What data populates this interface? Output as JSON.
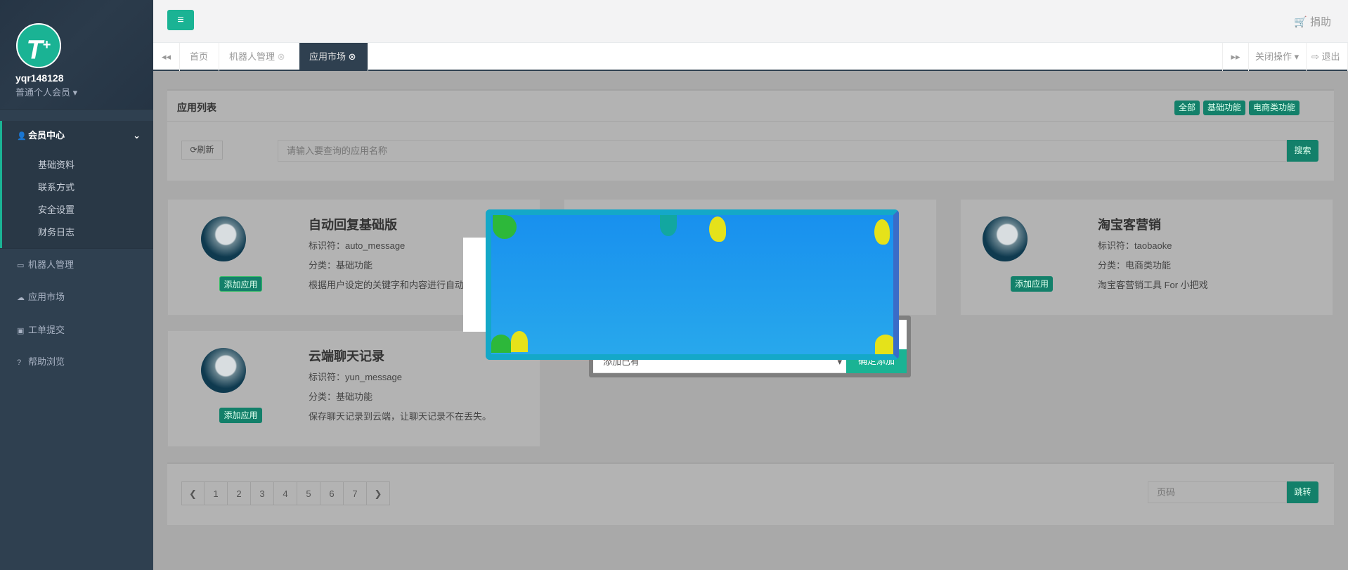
{
  "user": {
    "name": "yqr148128",
    "role": "普通个人会员",
    "logo_text": "T+"
  },
  "sidebar": {
    "items": [
      {
        "label": "会员中心",
        "icon": "user-icon",
        "children": [
          "基础资料",
          "联系方式",
          "安全设置",
          "财务日志"
        ]
      },
      {
        "label": "机器人管理",
        "icon": "desktop-icon"
      },
      {
        "label": "应用市场",
        "icon": "cloud-icon"
      },
      {
        "label": "工单提交",
        "icon": "calendar-plus-icon"
      },
      {
        "label": "帮助浏览",
        "icon": "question-circle-icon"
      }
    ]
  },
  "header": {
    "donate": "捐助"
  },
  "tabs": {
    "items": [
      "首页",
      "机器人管理",
      "应用市场"
    ],
    "close_ops": "关闭操作",
    "logout": "退出"
  },
  "panel": {
    "title": "应用列表",
    "filters": [
      "全部",
      "基础功能",
      "电商类功能"
    ],
    "refresh": "刷新",
    "search_placeholder": "请输入要查询的应用名称",
    "search": "搜索"
  },
  "cards": [
    {
      "title": "自动回复基础版",
      "id": "标识符：auto_message",
      "cat": "分类：基础功能",
      "desc": "根据用户设定的关键字和内容进行自动",
      "btn": "添加应用"
    },
    {
      "title": "",
      "id": "",
      "cat": "",
      "desc": "",
      "btn": ""
    },
    {
      "title": "淘宝客营销",
      "id": "标识符：taobaoke",
      "cat": "分类：电商类功能",
      "desc": "淘宝客营销工具 For 小把戏",
      "btn": "添加应用"
    },
    {
      "title": "云端聊天记录",
      "id": "标识符：yun_message",
      "cat": "分类：基础功能",
      "desc": "保存聊天记录到云端，让聊天记录不在丢失。",
      "btn": "添加应用"
    }
  ],
  "pagination": {
    "pages": [
      "1",
      "2",
      "3",
      "4",
      "5",
      "6",
      "7"
    ],
    "page_placeholder": "页码",
    "jump": "跳转"
  },
  "dialog": {
    "select_value": "添加已有",
    "confirm": "确定添加"
  },
  "colors": {
    "accent": "#1ab394",
    "sidebar": "#2f4050"
  }
}
